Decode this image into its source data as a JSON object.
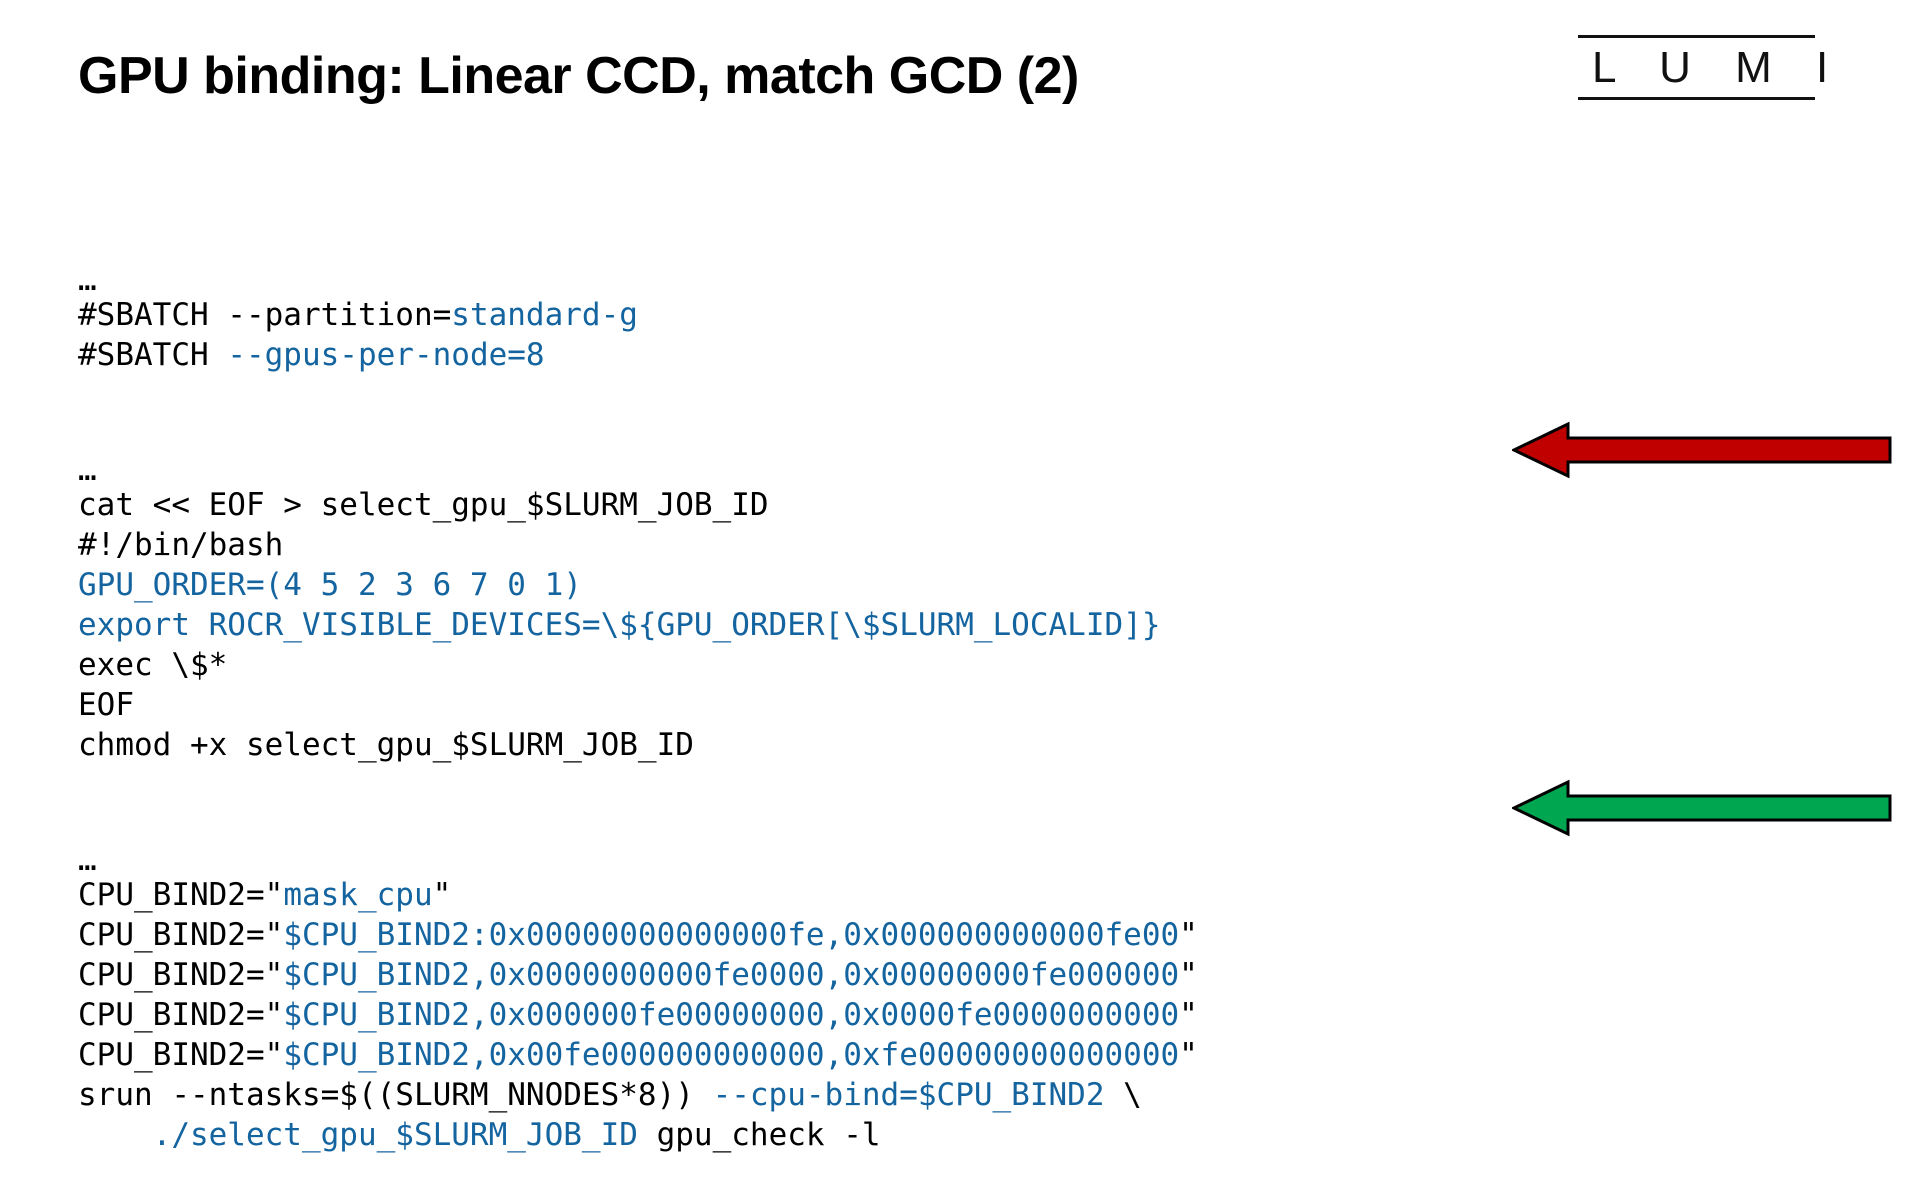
{
  "slide": {
    "title": "GPU binding: Linear CCD, match GCD (2)",
    "logo": {
      "name": "lumi-logo",
      "letters": "L U M I"
    }
  },
  "colors": {
    "text": "#000000",
    "code_highlight": "#1464a0",
    "arrow_red": "#c00000",
    "arrow_red_border": "#000000",
    "arrow_green": "#00a650",
    "arrow_green_border": "#000000",
    "background": "#ffffff"
  },
  "code": {
    "block_1": [
      {
        "id": "ellipsis-1",
        "segments": [
          {
            "text": "…",
            "style": "blk"
          }
        ]
      },
      {
        "id": "sbatch-partition",
        "segments": [
          {
            "text": "#SBATCH --partition=",
            "style": "blk"
          },
          {
            "text": "standard-g",
            "style": "blue"
          }
        ]
      },
      {
        "id": "sbatch-gpus-per-node",
        "segments": [
          {
            "text": "#SBATCH ",
            "style": "blk"
          },
          {
            "text": "--gpus-per-node=8",
            "style": "blue"
          }
        ]
      }
    ],
    "block_2": [
      {
        "id": "ellipsis-2",
        "segments": [
          {
            "text": "…",
            "style": "blk"
          }
        ]
      },
      {
        "id": "cat-heredoc",
        "segments": [
          {
            "text": "cat << EOF > select_gpu_$SLURM_JOB_ID",
            "style": "blk"
          }
        ]
      },
      {
        "id": "shebang",
        "segments": [
          {
            "text": "#!/bin/bash",
            "style": "blk"
          }
        ]
      },
      {
        "id": "gpu-order",
        "segments": [
          {
            "text": "GPU_ORDER=(4 5 2 3 6 7 0 1)",
            "style": "blue"
          }
        ]
      },
      {
        "id": "export-rocr",
        "segments": [
          {
            "text": "export ROCR_VISIBLE_DEVICES=\\${GPU_ORDER[\\$SLURM_LOCALID]}",
            "style": "blue"
          }
        ]
      },
      {
        "id": "exec-args",
        "segments": [
          {
            "text": "exec \\$*",
            "style": "blk"
          }
        ]
      },
      {
        "id": "eof-marker",
        "segments": [
          {
            "text": "EOF",
            "style": "blk"
          }
        ]
      },
      {
        "id": "chmod-select-gpu",
        "segments": [
          {
            "text": "chmod +x select_gpu_$SLURM_JOB_ID",
            "style": "blk"
          }
        ]
      }
    ],
    "block_3": [
      {
        "id": "ellipsis-3",
        "segments": [
          {
            "text": "…",
            "style": "blk"
          }
        ]
      },
      {
        "id": "cpu-bind2-init",
        "segments": [
          {
            "text": "CPU_BIND2=\"",
            "style": "blk"
          },
          {
            "text": "mask_cpu",
            "style": "blue"
          },
          {
            "text": "\"",
            "style": "blk"
          }
        ]
      },
      {
        "id": "cpu-bind2-mask-1",
        "segments": [
          {
            "text": "CPU_BIND2=\"",
            "style": "blk"
          },
          {
            "text": "$CPU_BIND2:0x00000000000000fe,0x000000000000fe00",
            "style": "blue"
          },
          {
            "text": "\"",
            "style": "blk"
          }
        ]
      },
      {
        "id": "cpu-bind2-mask-2",
        "segments": [
          {
            "text": "CPU_BIND2=\"",
            "style": "blk"
          },
          {
            "text": "$CPU_BIND2,0x0000000000fe0000,0x00000000fe000000",
            "style": "blue"
          },
          {
            "text": "\"",
            "style": "blk"
          }
        ]
      },
      {
        "id": "cpu-bind2-mask-3",
        "segments": [
          {
            "text": "CPU_BIND2=\"",
            "style": "blk"
          },
          {
            "text": "$CPU_BIND2,0x000000fe00000000,0x0000fe0000000000",
            "style": "blue"
          },
          {
            "text": "\"",
            "style": "blk"
          }
        ]
      },
      {
        "id": "cpu-bind2-mask-4",
        "segments": [
          {
            "text": "CPU_BIND2=\"",
            "style": "blk"
          },
          {
            "text": "$CPU_BIND2,0x00fe000000000000,0xfe00000000000000",
            "style": "blue"
          },
          {
            "text": "\"",
            "style": "blk"
          }
        ]
      },
      {
        "id": "srun-line",
        "segments": [
          {
            "text": "srun --ntasks=$((SLURM_NNODES*8)) ",
            "style": "blk"
          },
          {
            "text": "--cpu-bind=$CPU_BIND2",
            "style": "blue"
          },
          {
            "text": " \\",
            "style": "blk"
          }
        ]
      },
      {
        "id": "srun-continuation",
        "segments": [
          {
            "text": "    ",
            "style": "blk"
          },
          {
            "text": "./select_gpu_$SLURM_JOB_ID",
            "style": "blue"
          },
          {
            "text": " gpu_check -l",
            "style": "blk"
          }
        ]
      }
    ]
  },
  "annotations": [
    {
      "id": "arrow-red",
      "name": "red-arrow-callout",
      "color": "#c00000",
      "points_to": "GPU_ORDER=(4 5 2 3 6 7 0 1)",
      "direction": "left"
    },
    {
      "id": "arrow-green",
      "name": "green-arrow-callout",
      "color": "#00a650",
      "points_to": "CPU_BIND2 mask line 3",
      "direction": "left"
    }
  ]
}
